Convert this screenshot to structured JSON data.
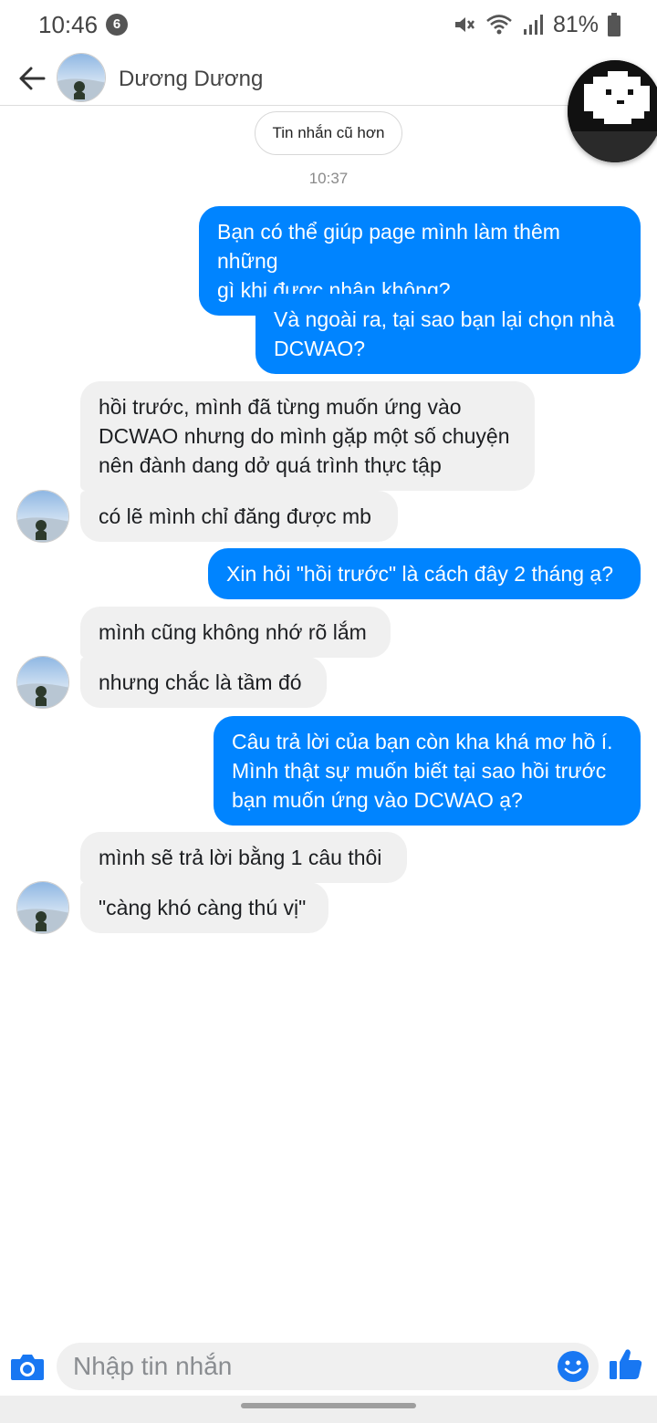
{
  "status_bar": {
    "time": "10:46",
    "notification_count": "6",
    "battery": "81%",
    "icons": [
      "mute-icon",
      "wifi-icon",
      "signal-icon",
      "battery-icon"
    ]
  },
  "header": {
    "contact_name": "Dương Dương",
    "back_icon": "back-arrow-icon"
  },
  "chat": {
    "older_button_label": "Tin nhắn cũ hơn",
    "timestamp": "10:37",
    "messages": [
      {
        "from": "me",
        "lines": [
          "Bạn có thể giúp page mình làm thêm những",
          "gì khi được nhận không?"
        ]
      },
      {
        "from": "me",
        "lines": [
          "Và ngoài ra, tại sao bạn lại chọn nhà",
          "DCWAO?"
        ]
      },
      {
        "from": "them",
        "lines": [
          "hồi trước, mình đã từng muốn ứng vào",
          "DCWAO nhưng do mình gặp một số chuyện",
          "nên đành dang dở quá trình thực tập"
        ]
      },
      {
        "from": "them",
        "lines": [
          "có lẽ mình chỉ đăng được mb"
        ]
      },
      {
        "from": "me",
        "lines": [
          "Xin hỏi \"hồi trước\" là cách đây 2 tháng ạ?"
        ]
      },
      {
        "from": "them",
        "lines": [
          "mình cũng không nhớ rõ lắm"
        ]
      },
      {
        "from": "them",
        "lines": [
          "nhưng chắc là tầm đó"
        ]
      },
      {
        "from": "me",
        "lines": [
          "Câu trả lời của bạn còn kha khá mơ hồ í.",
          "Mình thật sự muốn biết tại sao hồi trước",
          "bạn muốn ứng vào DCWAO ạ?"
        ]
      },
      {
        "from": "them",
        "lines": [
          "mình sẽ trả lời bằng 1 câu thôi"
        ]
      },
      {
        "from": "them",
        "lines": [
          "\"càng khó càng thú vị\""
        ]
      }
    ]
  },
  "composer": {
    "placeholder": "Nhập tin nhắn",
    "icons": [
      "camera-icon",
      "emoji-icon",
      "thumbs-up-icon"
    ]
  },
  "colors": {
    "outgoing_bubble": "#0084ff",
    "incoming_bubble": "#f0f0f0",
    "accent": "#1877f2"
  }
}
